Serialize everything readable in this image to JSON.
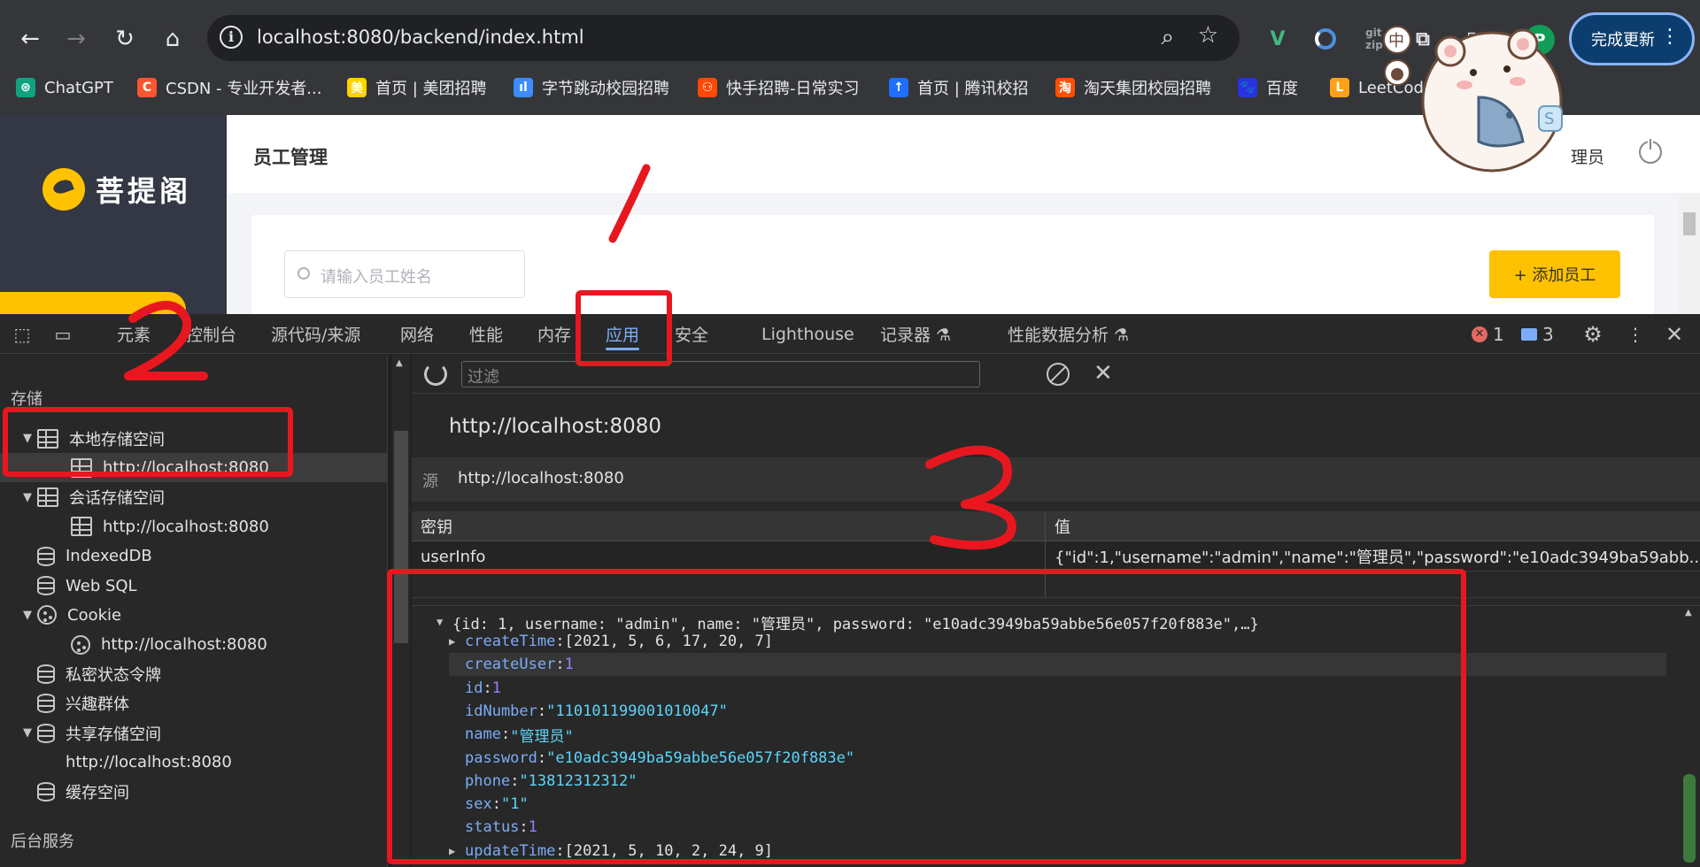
{
  "browser": {
    "url": "localhost:8080/backend/index.html",
    "update_button": "完成更新",
    "profile_initial": "P",
    "extensions": [
      "vue-icon",
      "sync-icon",
      "gitzip-icon",
      "puzzle-icon",
      "sidebar-icon"
    ],
    "bookmarks": [
      {
        "label": "ChatGPT",
        "icon": "chatgpt-icon",
        "color": "#10a37f",
        "glyph": "⊛"
      },
      {
        "label": "CSDN - 专业开发者...",
        "icon": "csdn-icon",
        "color": "#fc5531",
        "glyph": "C"
      },
      {
        "label": "首页 | 美团招聘",
        "icon": "meituan-icon",
        "color": "#ffd100",
        "glyph": "美"
      },
      {
        "label": "字节跳动校园招聘",
        "icon": "bytedance-icon",
        "color": "#3c8cff",
        "glyph": "ıl"
      },
      {
        "label": "快手招聘-日常实习",
        "icon": "kuaishou-icon",
        "color": "#ff4906",
        "glyph": "⚇"
      },
      {
        "label": "首页 | 腾讯校招",
        "icon": "tencent-icon",
        "color": "#1e6fff",
        "glyph": "↑"
      },
      {
        "label": "淘天集团校园招聘",
        "icon": "taobao-icon",
        "color": "#ff5000",
        "glyph": "淘"
      },
      {
        "label": "百度",
        "icon": "baidu-icon",
        "color": "#2932e1",
        "glyph": "🐾"
      },
      {
        "label": "LeetCode",
        "icon": "leetcode-icon",
        "color": "#ffa116",
        "glyph": "L"
      }
    ]
  },
  "page": {
    "logo_text": "菩提阁",
    "header_title": "员工管理",
    "admin_label": "理员",
    "search_placeholder": "请输入员工姓名",
    "add_button": "+ 添加员工",
    "accent": "#ffc200"
  },
  "sticker": {
    "badge_top": "中",
    "badge_letter": "S"
  },
  "devtools": {
    "tabs": [
      "元素",
      "控制台",
      "源代码/来源",
      "网络",
      "性能",
      "内存",
      "应用",
      "安全",
      "Lighthouse",
      "记录器 ⚗",
      "性能数据分析 ⚗"
    ],
    "active_tab": "应用",
    "error_count": "1",
    "message_count": "3",
    "storage_title": "存储",
    "tree": [
      {
        "label": "本地存储空间",
        "icon": "grid",
        "expand": "▼",
        "indent": 0
      },
      {
        "label": "http://localhost:8080",
        "icon": "grid",
        "expand": "",
        "indent": 1,
        "selected": true
      },
      {
        "label": "会话存储空间",
        "icon": "grid",
        "expand": "▼",
        "indent": 0
      },
      {
        "label": "http://localhost:8080",
        "icon": "grid",
        "expand": "",
        "indent": 1
      },
      {
        "label": "IndexedDB",
        "icon": "db",
        "expand": "",
        "indent": 0
      },
      {
        "label": "Web SQL",
        "icon": "db",
        "expand": "",
        "indent": 0
      },
      {
        "label": "Cookie",
        "icon": "ck",
        "expand": "▼",
        "indent": 0
      },
      {
        "label": "http://localhost:8080",
        "icon": "ck",
        "expand": "",
        "indent": 1
      },
      {
        "label": "私密状态令牌",
        "icon": "db",
        "expand": "",
        "indent": 0
      },
      {
        "label": "兴趣群体",
        "icon": "db",
        "expand": "",
        "indent": 0
      },
      {
        "label": "共享存储空间",
        "icon": "db",
        "expand": "▼",
        "indent": 0
      },
      {
        "label": "http://localhost:8080",
        "icon": "",
        "expand": "",
        "indent": 2
      },
      {
        "label": "缓存空间",
        "icon": "db",
        "expand": "",
        "indent": 0
      }
    ],
    "background_services_title": "后台服务",
    "filter_placeholder": "过滤",
    "origin_title": "http://localhost:8080",
    "source_label": "源",
    "source_value": "http://localhost:8080",
    "key_header": "密钥",
    "value_header": "值",
    "entries": [
      {
        "key": "userInfo",
        "value": "{\"id\":1,\"username\":\"admin\",\"name\":\"管理员\",\"password\":\"e10adc3949ba59abb..."
      }
    ],
    "preview": {
      "summary": "{id: 1, username: \"admin\", name: \"管理员\", password: \"e10adc3949ba59abbe56e057f20f883e\",…}",
      "fields": [
        {
          "key": "createTime",
          "value": "[2021, 5, 6, 17, 20, 7]",
          "kind": "array",
          "expand": "▶"
        },
        {
          "key": "createUser",
          "value": "1",
          "kind": "num",
          "expand": "",
          "highlight": true
        },
        {
          "key": "id",
          "value": "1",
          "kind": "num",
          "expand": ""
        },
        {
          "key": "idNumber",
          "value": "\"110101199001010047\"",
          "kind": "str",
          "expand": ""
        },
        {
          "key": "name",
          "value": "\"管理员\"",
          "kind": "str",
          "expand": ""
        },
        {
          "key": "password",
          "value": "\"e10adc3949ba59abbe56e057f20f883e\"",
          "kind": "str",
          "expand": ""
        },
        {
          "key": "phone",
          "value": "\"13812312312\"",
          "kind": "str",
          "expand": ""
        },
        {
          "key": "sex",
          "value": "\"1\"",
          "kind": "str",
          "expand": ""
        },
        {
          "key": "status",
          "value": "1",
          "kind": "num",
          "expand": ""
        },
        {
          "key": "updateTime",
          "value": "[2021, 5, 10, 2, 24, 9]",
          "kind": "array",
          "expand": "▶"
        }
      ]
    }
  },
  "annotations": [
    "1",
    "2",
    "3"
  ]
}
